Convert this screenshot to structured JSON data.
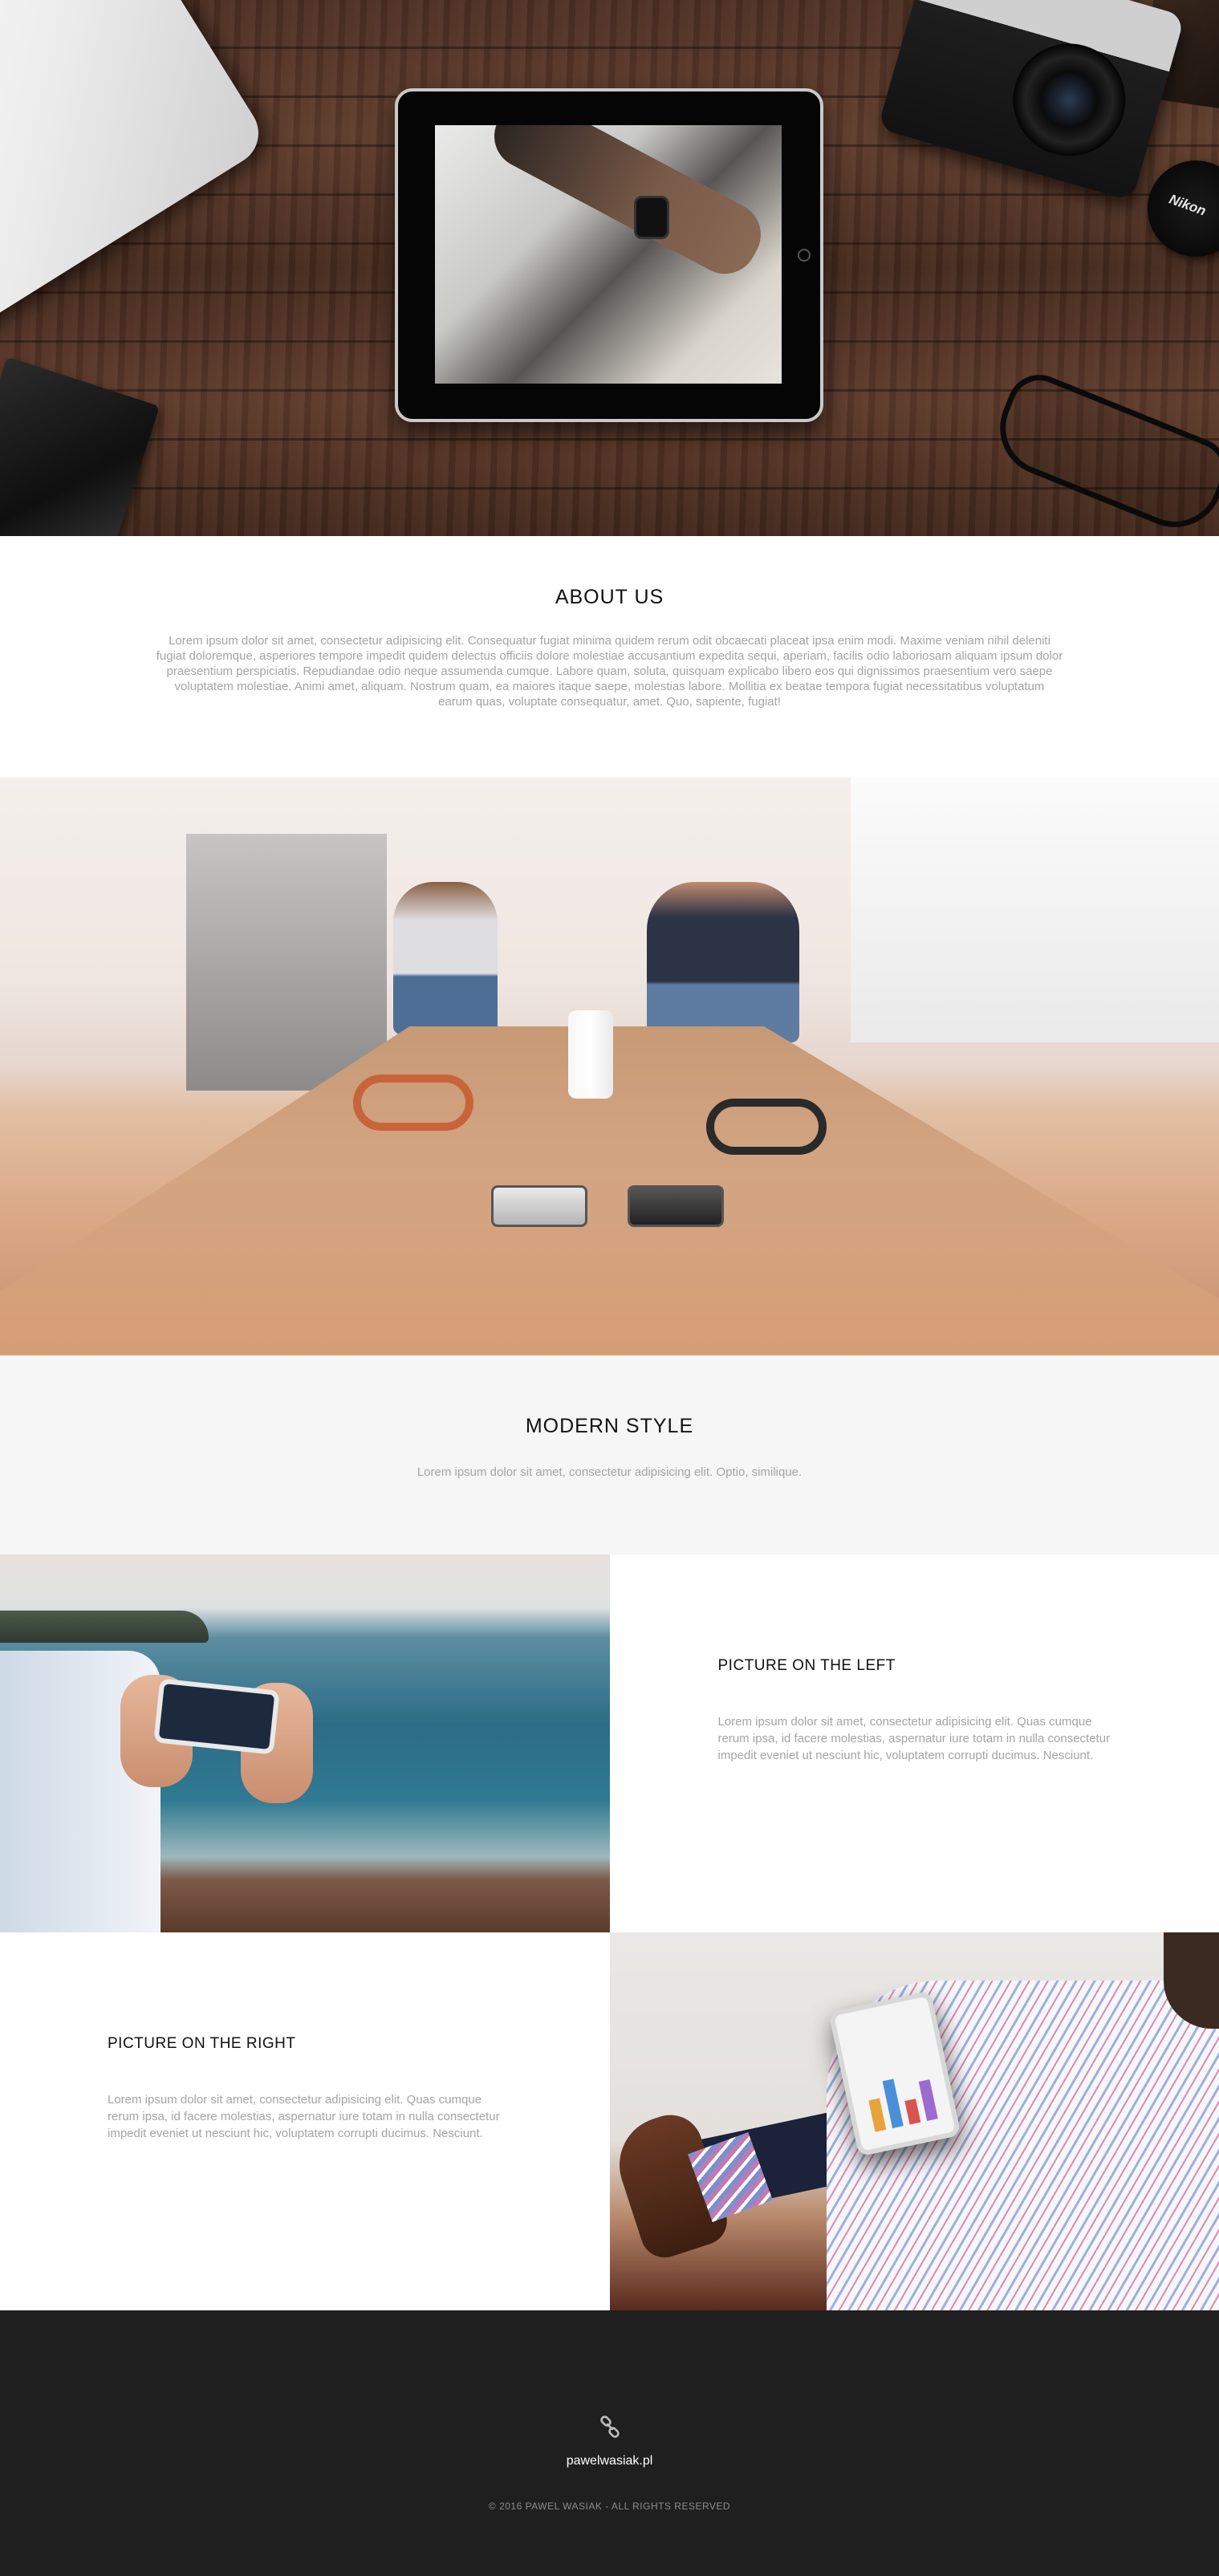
{
  "about": {
    "title": "ABOUT US",
    "text": "Lorem ipsum dolor sit amet, consectetur adipisicing elit. Consequatur fugiat minima quidem rerum odit obcaecati placeat ipsa enim modi. Maxime veniam nihil deleniti fugiat doloremque, asperiores tempore impedit quidem delectus officiis dolore molestiae accusantium expedita sequi, aperiam, facilis odio laboriosam aliquam ipsum dolor praesentium perspiciatis. Repudiandae odio neque assumenda cumque. Labore quam, soluta, quisquam explicabo libero eos qui dignissimos praesentium vero saepe voluptatem molestiae. Animi amet, aliquam. Nostrum quam, ea maiores itaque saepe, molestias labore. Mollitia ex beatae tempora fugiat necessitatibus voluptatum earum quas, voluptate consequatur, amet. Quo, sapiente, fugiat!"
  },
  "hero": {
    "lens_cap_brand": "Nikon"
  },
  "modern": {
    "title": "MODERN STYLE",
    "text": "Lorem ipsum dolor sit amet, consectetur adipisicing elit. Optio, similique."
  },
  "picture_left": {
    "title": "PICTURE ON THE LEFT",
    "text": "Lorem ipsum dolor sit amet, consectetur adipisicing elit. Quas cumque rerum ipsa, id facere molestias, aspernatur iure totam in nulla consectetur impedit eveniet ut nesciunt hic, voluptatem corrupti ducimus. Nesciunt."
  },
  "picture_right": {
    "title": "PICTURE ON THE RIGHT",
    "text": "Lorem ipsum dolor sit amet, consectetur adipisicing elit. Quas cumque rerum ipsa, id facere molestias, aspernatur iure totam in nulla consectetur impedit eveniet ut nesciunt hic, voluptatem corrupti ducimus. Nesciunt."
  },
  "footer": {
    "icon": "link-icon",
    "site_name": "pawelwasiak.pl",
    "copyright": "© 2016 PAWEL WASIAK - ALL RIGHTS RESERVED"
  },
  "colors": {
    "footer_bg": "#1f1f1f",
    "muted_text": "#a4a4a4",
    "section_grey": "#f6f6f6"
  }
}
